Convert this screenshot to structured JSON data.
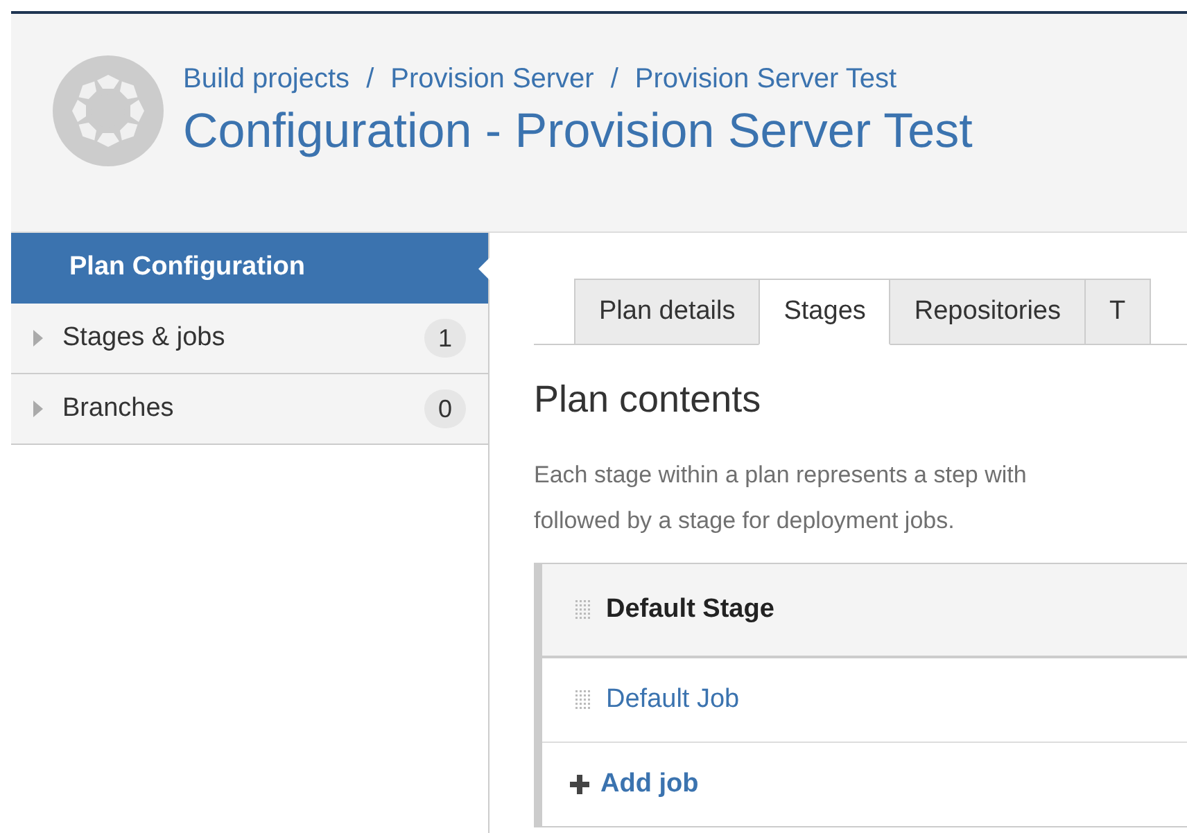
{
  "header": {
    "breadcrumbs": [
      "Build projects",
      "Provision Server",
      "Provision Server Test"
    ],
    "separator": "/",
    "title": "Configuration - Provision Server Test"
  },
  "sidebar": {
    "items": [
      {
        "label": "Plan Configuration",
        "selected": true,
        "kind": "heading"
      },
      {
        "label": "Stages & jobs",
        "count": "1",
        "selected": false,
        "kind": "expander"
      },
      {
        "label": "Branches",
        "count": "0",
        "selected": false,
        "kind": "expander"
      }
    ]
  },
  "tabs": [
    {
      "label": "Plan details",
      "selected": false
    },
    {
      "label": "Stages",
      "selected": true
    },
    {
      "label": "Repositories",
      "selected": false
    },
    {
      "label": "T",
      "selected": false
    }
  ],
  "section": {
    "heading": "Plan contents",
    "description_lines": [
      "Each stage within a plan represents a step with",
      "followed by a stage for deployment jobs."
    ]
  },
  "stage": {
    "name": "Default Stage",
    "jobs": [
      "Default Job"
    ],
    "add_label": "Add job"
  }
}
